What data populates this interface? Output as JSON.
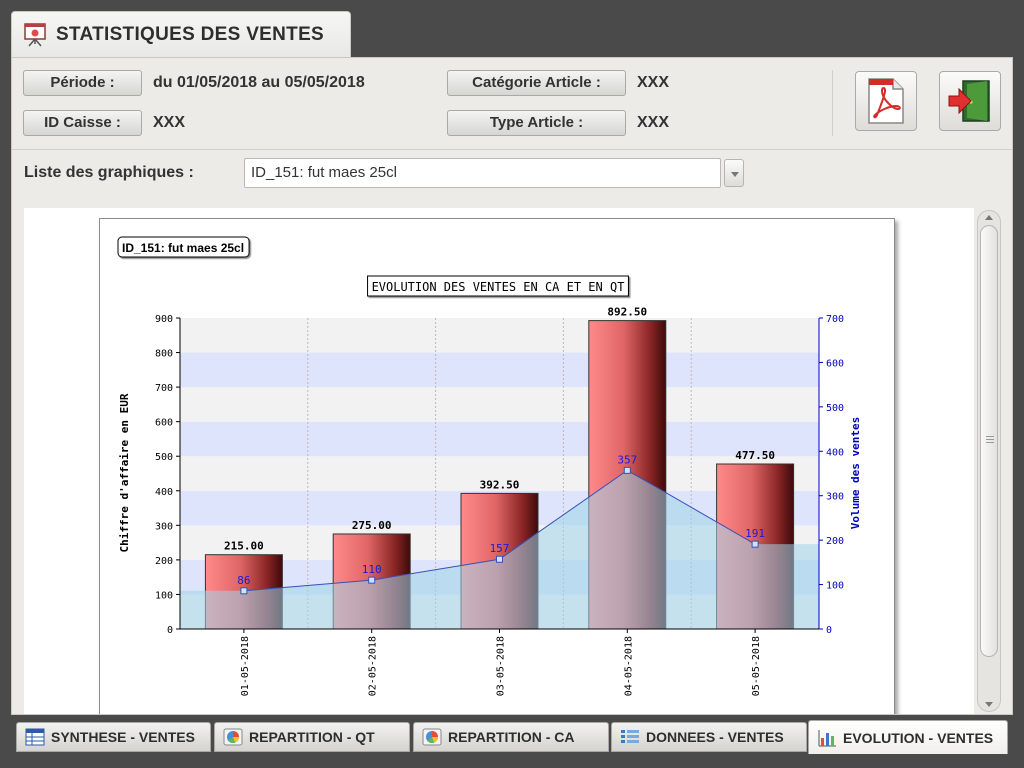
{
  "window": {
    "title": "STATISTIQUES DES VENTES"
  },
  "info": {
    "periode_label": "Période :",
    "periode_value": "du 01/05/2018 au 05/05/2018",
    "caisse_label": "ID Caisse :",
    "caisse_value": "XXX",
    "categorie_label": "Catégorie Article :",
    "categorie_value": "XXX",
    "type_label": "Type Article :",
    "type_value": "XXX"
  },
  "icons": {
    "pdf": "pdf-export-icon",
    "exit": "exit-door-icon"
  },
  "graph_list": {
    "label": "Liste des graphiques :",
    "selected": "ID_151: fut maes 25cl"
  },
  "tabs": [
    {
      "label": "SYNTHESE - VENTES",
      "icon": "table-icon"
    },
    {
      "label": "REPARTITION - QT",
      "icon": "pie-chart-icon"
    },
    {
      "label": "REPARTITION - CA",
      "icon": "pie-chart-icon"
    },
    {
      "label": "DONNEES - VENTES",
      "icon": "list-icon"
    },
    {
      "label": "EVOLUTION - VENTES",
      "icon": "bar-chart-icon",
      "active": true
    }
  ],
  "chart_data": {
    "type": "bar",
    "title": "EVOLUTION DES VENTES EN CA ET EN QT",
    "item_label": "ID_151: fut maes 25cl",
    "categories": [
      "01-05-2018",
      "02-05-2018",
      "03-05-2018",
      "04-05-2018",
      "05-05-2018"
    ],
    "ylabel": "Chiffre d'affaire en EUR",
    "y2label": "Volume des ventes",
    "ylim": [
      0,
      900
    ],
    "y2lim": [
      0,
      700
    ],
    "yticks": [
      0,
      100,
      200,
      300,
      400,
      500,
      600,
      700,
      800,
      900
    ],
    "y2ticks": [
      0,
      100,
      200,
      300,
      400,
      500,
      600,
      700
    ],
    "series": [
      {
        "name": "CA",
        "type": "bar",
        "axis": "left",
        "values": [
          215.0,
          275.0,
          392.5,
          892.5,
          477.5
        ],
        "labels": [
          "215.00",
          "275.00",
          "392.50",
          "892.50",
          "477.50"
        ],
        "color": "#ff7b7b"
      },
      {
        "name": "QT",
        "type": "area",
        "axis": "right",
        "values": [
          86,
          110,
          157,
          357,
          191
        ],
        "labels": [
          "86",
          "110",
          "157",
          "357",
          "191"
        ],
        "color": "#2222cc",
        "fill": "#9fd4ea"
      }
    ],
    "grid": true,
    "band_colors": [
      "#f2f2f2",
      "#dde4fb"
    ]
  }
}
